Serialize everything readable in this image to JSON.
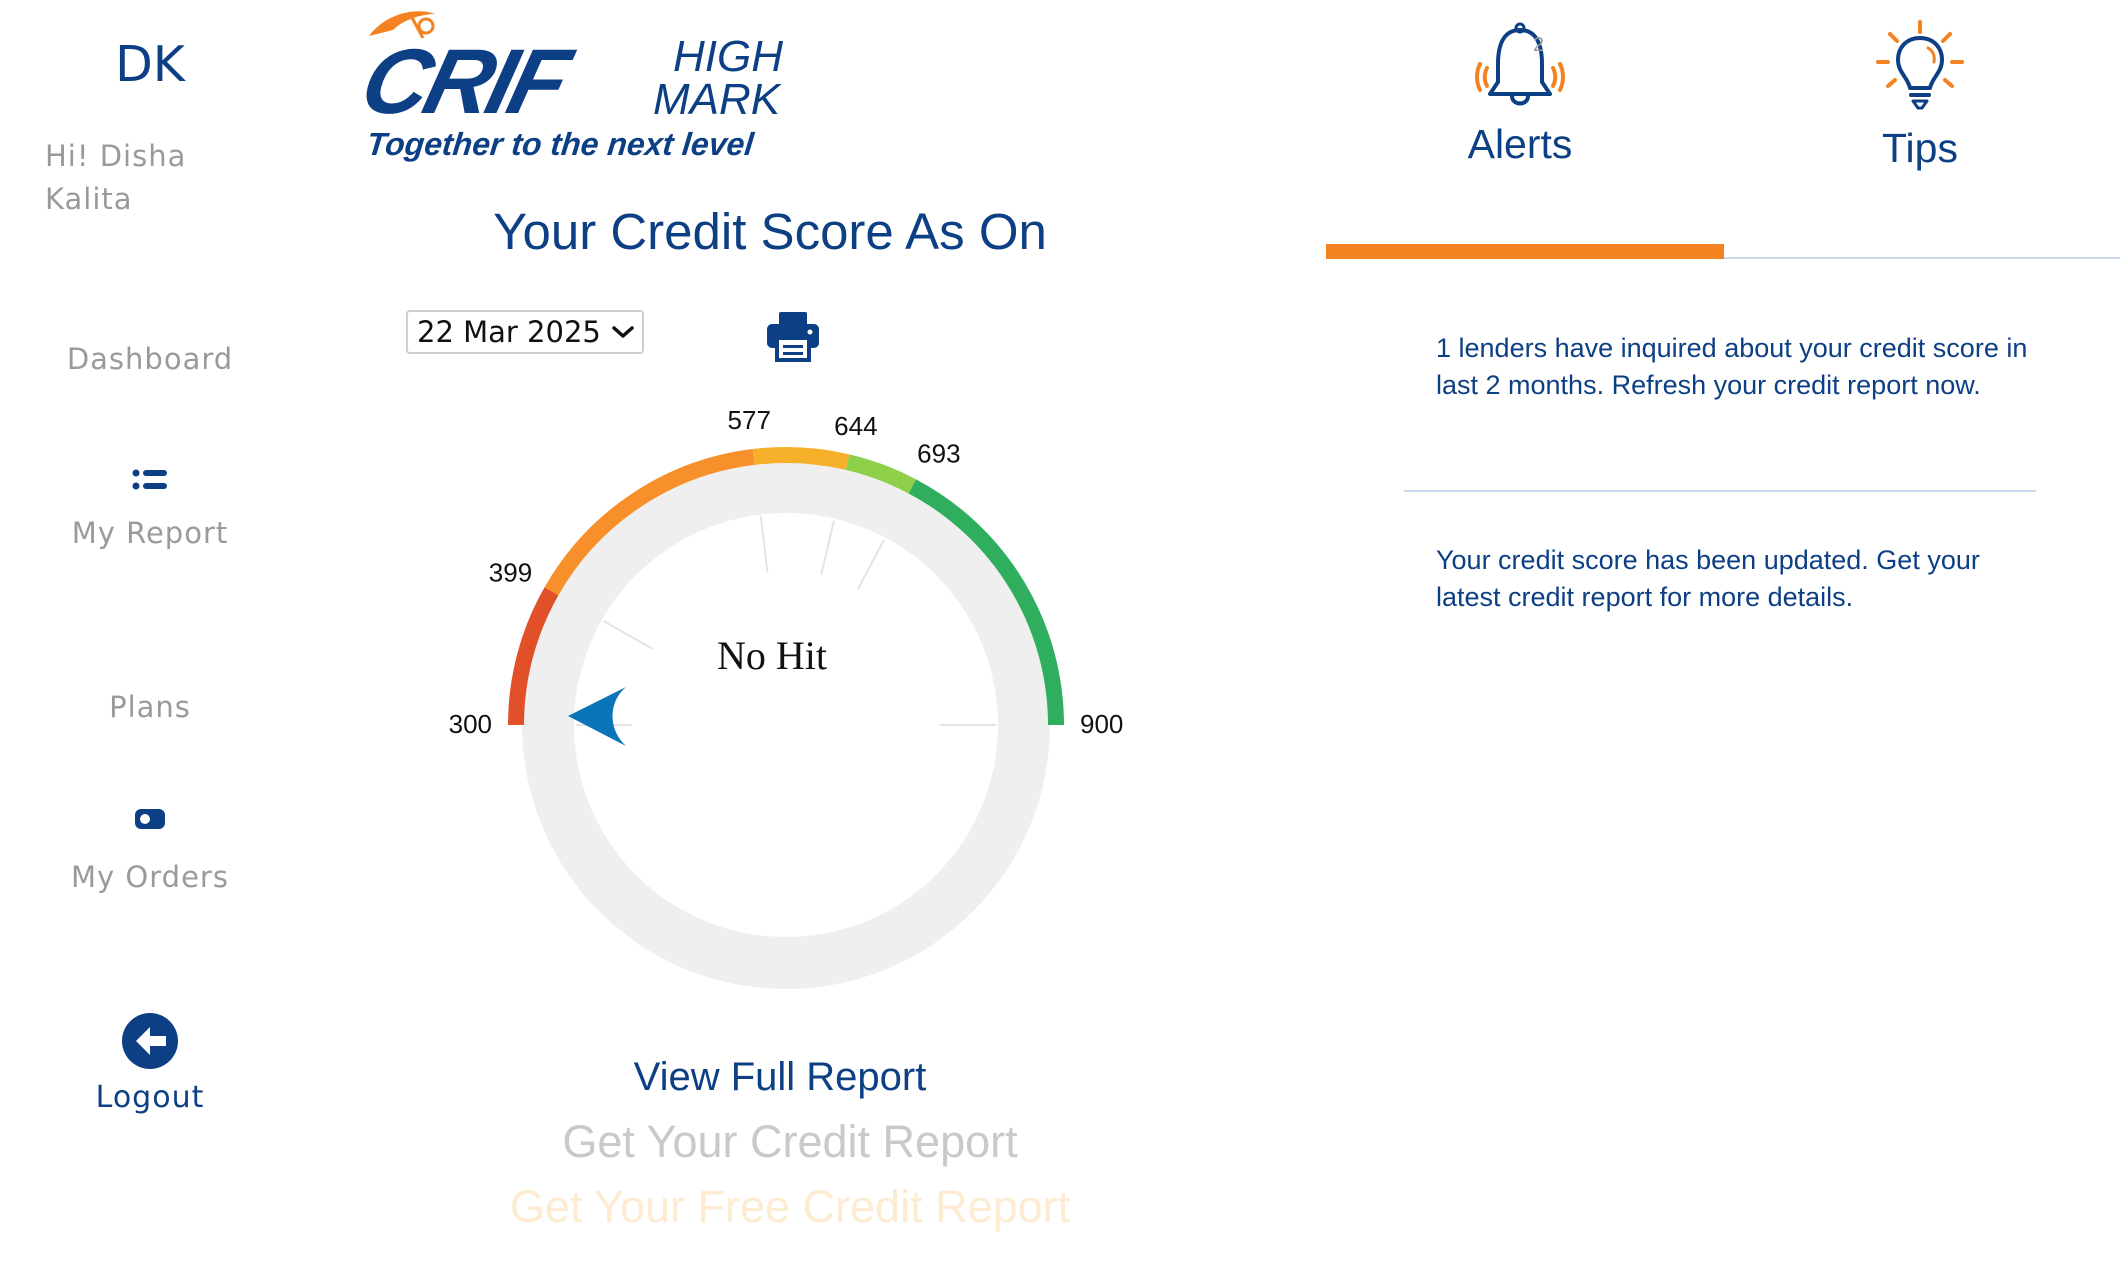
{
  "sidebar": {
    "initials": "DK",
    "greeting": "Hi! Disha Kalita",
    "items": [
      {
        "label": "Dashboard",
        "icon": "dashboard-icon"
      },
      {
        "label": "My Report",
        "icon": "list-icon"
      },
      {
        "label": "Plans",
        "icon": "plans-icon"
      },
      {
        "label": "My Orders",
        "icon": "orders-icon"
      }
    ],
    "logout_label": "Logout"
  },
  "logo": {
    "brand_top": "HIGH",
    "brand_bottom": "MARK",
    "brand_main": "CRIF",
    "tagline": "Together to the next level"
  },
  "score": {
    "title": "Your Credit Score As On",
    "selected_date": "22 Mar 2025",
    "status_text": "No Hit",
    "min": 300,
    "max": 900,
    "value": null,
    "bands": [
      {
        "from": 300,
        "to": 399,
        "color": "#e2502a"
      },
      {
        "from": 399,
        "to": 577,
        "color": "#f7902a"
      },
      {
        "from": 577,
        "to": 644,
        "color": "#f7b02a"
      },
      {
        "from": 644,
        "to": 693,
        "color": "#8fd04a"
      },
      {
        "from": 693,
        "to": 900,
        "color": "#2fae5e"
      }
    ],
    "tick_labels": [
      "300",
      "399",
      "577",
      "644",
      "693",
      "900"
    ],
    "pointer_color": "#0a74b8"
  },
  "actions": {
    "view_full_report": "View Full Report",
    "get_credit_report": "Get Your Credit Report",
    "get_free_credit_report": "Get Your Free Credit Report"
  },
  "tabs": {
    "alerts": {
      "label": "Alerts",
      "badge": "2"
    },
    "tips": {
      "label": "Tips"
    },
    "active": "alerts",
    "accent_color": "#f58220"
  },
  "alerts": [
    "1 lenders have inquired about your credit score in last 2 months. Refresh your credit report now.",
    "Your credit score has been updated. Get your latest credit report for more details."
  ]
}
